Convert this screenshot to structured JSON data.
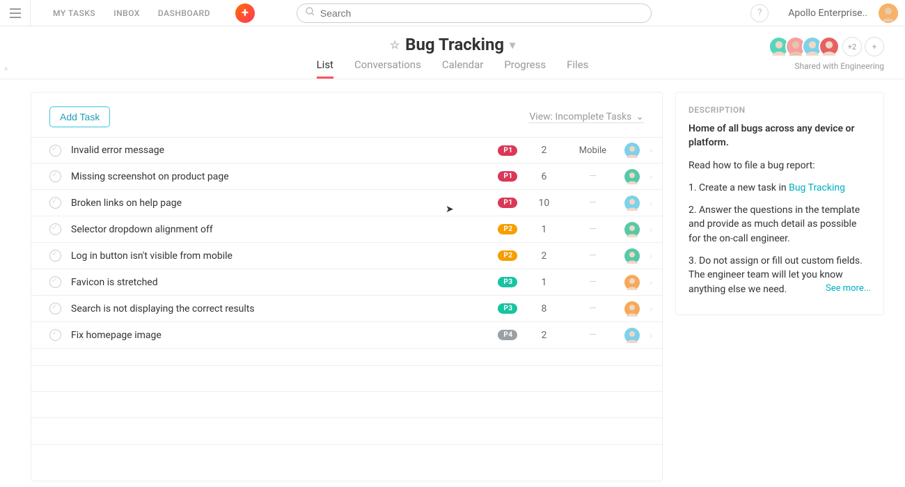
{
  "nav": {
    "my_tasks": "MY TASKS",
    "inbox": "INBOX",
    "dashboard": "DASHBOARD"
  },
  "search": {
    "placeholder": "Search"
  },
  "workspace": "Apollo Enterprise..",
  "project": {
    "title": "Bug Tracking",
    "tabs": {
      "list": "List",
      "conversations": "Conversations",
      "calendar": "Calendar",
      "progress": "Progress",
      "files": "Files"
    },
    "overflow": "+2",
    "shared_with": "Shared with Engineering"
  },
  "list": {
    "add_task": "Add Task",
    "view": "View: Incomplete Tasks"
  },
  "priority_colors": {
    "P1": "#d93857",
    "P2": "#f59f00",
    "P3": "#18c3a1",
    "P4": "#9aa0a6"
  },
  "assignee_colors": {
    "a": "#7ed1e8",
    "b": "#57c9a7",
    "c": "#f6a95b"
  },
  "tasks": [
    {
      "title": "Invalid error message",
      "priority": "P1",
      "count": "2",
      "platform": "Mobile",
      "assignee": "a"
    },
    {
      "title": "Missing screenshot on product page",
      "priority": "P1",
      "count": "6",
      "platform": "",
      "assignee": "b"
    },
    {
      "title": "Broken links on help page",
      "priority": "P1",
      "count": "10",
      "platform": "",
      "assignee": "a"
    },
    {
      "title": "Selector dropdown alignment off",
      "priority": "P2",
      "count": "1",
      "platform": "",
      "assignee": "b"
    },
    {
      "title": "Log in button isn't visible from mobile",
      "priority": "P2",
      "count": "2",
      "platform": "",
      "assignee": "b"
    },
    {
      "title": "Favicon is stretched",
      "priority": "P3",
      "count": "1",
      "platform": "",
      "assignee": "c"
    },
    {
      "title": "Search is not displaying the correct results",
      "priority": "P3",
      "count": "8",
      "platform": "",
      "assignee": "c"
    },
    {
      "title": "Fix homepage image",
      "priority": "P4",
      "count": "2",
      "platform": "",
      "assignee": "a"
    }
  ],
  "description": {
    "heading": "DESCRIPTION",
    "p1": "Home of all bugs across any device or platform.",
    "p2": "Read how to file a bug report:",
    "li1a": "1. Create a new task in ",
    "li1b": "Bug Tracking",
    "li2": "2. Answer the questions in the template and provide as much detail as possible for the on-call engineer.",
    "li3": "3. Do not assign or fill out custom fields. The engineer team will let you know anything else we need.",
    "see_more": "See more..."
  }
}
